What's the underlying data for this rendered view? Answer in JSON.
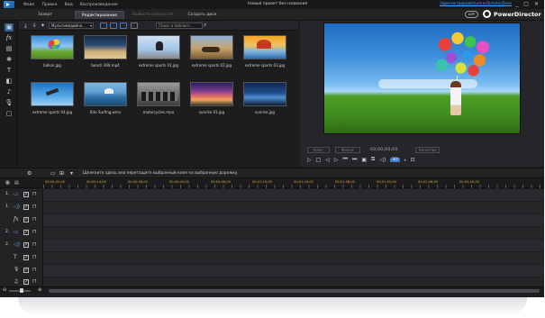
{
  "titlebar": {
    "menus": [
      "Файл",
      "Правка",
      "Вид",
      "Воспроизведение"
    ],
    "title": "Новый проект без названия",
    "register_link": "Зарегистрироваться в DirectorZone",
    "controls": [
      "_",
      "□",
      "✕"
    ]
  },
  "tabs": [
    {
      "label": "Захват",
      "state": "normal"
    },
    {
      "label": "Редактирование",
      "state": "active"
    },
    {
      "label": "Вывести результат",
      "state": "disabled"
    },
    {
      "label": "Создать диск",
      "state": "normal"
    }
  ],
  "brand": {
    "app_badge": "APP",
    "name": "PowerDirector"
  },
  "library": {
    "dropdown": "Мультимедийно...",
    "search_placeholder": "Поиск в библиот...",
    "items": [
      {
        "label": "ballon.jpg",
        "thumb": "t-balloon"
      },
      {
        "label": "beach 360.mp4",
        "thumb": "t-beach"
      },
      {
        "label": "extreme sports 01.jpg",
        "thumb": "t-bike1"
      },
      {
        "label": "extreme sports 02.jpg",
        "thumb": "t-bike2"
      },
      {
        "label": "extreme sports 03.jpg",
        "thumb": "t-sport3"
      },
      {
        "label": "extreme sports 04.jpg",
        "thumb": "t-sky"
      },
      {
        "label": "Kite Surfing.wmv",
        "thumb": "t-surf"
      },
      {
        "label": "motorcycles.mpo",
        "thumb": "t-moto"
      },
      {
        "label": "sunrise 01.jpg",
        "thumb": "t-sunrise"
      },
      {
        "label": "sunrise.jpg",
        "thumb": "t-sunset"
      }
    ]
  },
  "preview": {
    "mode_clip": "Клип",
    "mode_movie": "Фильм",
    "timecode": "00;00;00;00",
    "quality": "Качество",
    "badge_3d": "3D"
  },
  "timeline": {
    "hint": "Щелкните здесь или перетащите выбранный клип на выбранную дорожку.",
    "ruler": [
      "00;00;00;00",
      "00;00;14;00",
      "00;00;28;00",
      "00;00;42;00",
      "00;00;56;00",
      "00;01;10;00",
      "00;01;24;00",
      "00;01;38;00",
      "00;01;52;00",
      "00;02;06;00",
      "00;02;20;00"
    ],
    "tracks": [
      {
        "num": "1.",
        "icon": "▭",
        "kind": "video"
      },
      {
        "num": "1.",
        "icon": "◁)",
        "kind": "audio"
      },
      {
        "num": "",
        "icon": "fx",
        "kind": "fx"
      },
      {
        "num": "2.",
        "icon": "▭",
        "kind": "video"
      },
      {
        "num": "2.",
        "icon": "◁)",
        "kind": "audio"
      },
      {
        "num": "",
        "icon": "T",
        "kind": "title"
      },
      {
        "num": "",
        "icon": "🎙",
        "kind": "voice"
      },
      {
        "num": "",
        "icon": "♫",
        "kind": "music"
      }
    ]
  }
}
